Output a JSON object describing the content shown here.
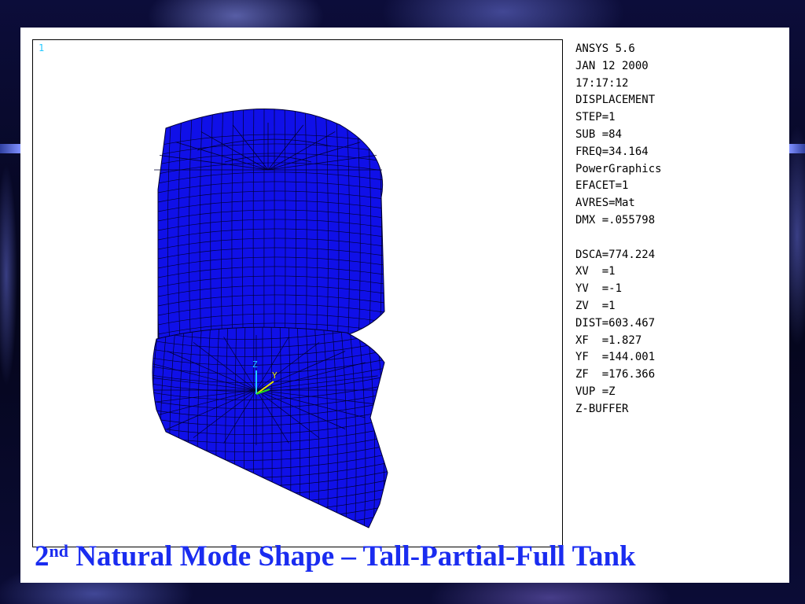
{
  "colors": {
    "mesh_fill": "#1010e8",
    "mesh_lines": "#000033",
    "title": "#1a2cf0",
    "window_number": "#22c8ff",
    "triad_z": "#22c8ff",
    "triad_y": "#e8e800",
    "triad_x": "#22dd22"
  },
  "viewport": {
    "window_number": "1",
    "triad": {
      "z_label": "Z",
      "y_label": "Y"
    }
  },
  "info_panel": {
    "block1": [
      "ANSYS 5.6",
      "JAN 12 2000",
      "17:17:12",
      "DISPLACEMENT",
      "STEP=1",
      "SUB =84",
      "FREQ=34.164",
      "PowerGraphics",
      "EFACET=1",
      "AVRES=Mat",
      "DMX =.055798"
    ],
    "block2": [
      "DSCA=774.224",
      "XV  =1",
      "YV  =-1",
      "ZV  =1",
      "DIST=603.467",
      "XF  =1.827",
      "YF  =144.001",
      "ZF  =176.366",
      "VUP =Z",
      "Z-BUFFER"
    ]
  },
  "title": {
    "num": "2",
    "sup": "nd",
    "rest": " Natural Mode Shape – Tall-Partial-Full Tank"
  }
}
